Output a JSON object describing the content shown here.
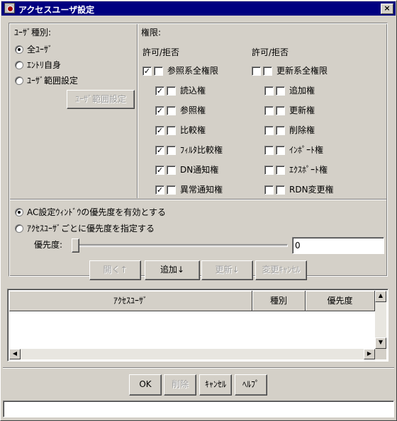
{
  "window": {
    "title": "アクセスユーザ設定",
    "close_glyph": "×"
  },
  "user_type": {
    "heading": "ﾕｰｻﾞ種別:",
    "options": [
      {
        "label": "全ﾕｰｻﾞ",
        "selected": true
      },
      {
        "label": "ｴﾝﾄﾘ自身",
        "selected": false
      },
      {
        "label": "ﾕｰｻﾞ範囲設定",
        "selected": false
      }
    ],
    "range_button": "ﾕｰｻﾞ範囲設定"
  },
  "permissions": {
    "heading": "権限:",
    "left_col_header": "許可/拒否",
    "right_col_header": "許可/拒否",
    "left": [
      {
        "label": "参照系全権限",
        "allow": true,
        "deny": false
      },
      {
        "label": "読込権",
        "allow": true,
        "deny": false
      },
      {
        "label": "参照権",
        "allow": true,
        "deny": false
      },
      {
        "label": "比較権",
        "allow": true,
        "deny": false
      },
      {
        "label": "ﾌｨﾙﾀ比較権",
        "allow": true,
        "deny": false
      },
      {
        "label": "DN通知権",
        "allow": true,
        "deny": false
      },
      {
        "label": "異常通知権",
        "allow": true,
        "deny": false
      }
    ],
    "right": [
      {
        "label": "更新系全権限",
        "allow": false,
        "deny": false
      },
      {
        "label": "追加権",
        "allow": false,
        "deny": false
      },
      {
        "label": "更新権",
        "allow": false,
        "deny": false
      },
      {
        "label": "削除権",
        "allow": false,
        "deny": false
      },
      {
        "label": "ｲﾝﾎﾟｰﾄ権",
        "allow": false,
        "deny": false
      },
      {
        "label": "ｴｸｽﾎﾟｰﾄ権",
        "allow": false,
        "deny": false
      },
      {
        "label": "RDN変更権",
        "allow": false,
        "deny": false
      }
    ]
  },
  "priority": {
    "opt_enable": "AC設定ｳｨﾝﾄﾞｳの優先度を有効とする",
    "opt_per_user": "ｱｸｾｽﾕｰｻﾞごとに優先度を指定する",
    "selected": "opt_enable",
    "label": "優先度:",
    "value": "0",
    "slider_level": 0
  },
  "actions": {
    "open": "開く↑",
    "add": "追加↓",
    "update": "更新↓",
    "cancel_change": "変更ｷｬﾝｾﾙ"
  },
  "table": {
    "headers": [
      "ｱｸｾｽﾕｰｻﾞ",
      "種別",
      "優先度"
    ],
    "rows": []
  },
  "footer": {
    "ok": "OK",
    "delete": "削除",
    "cancel": "ｷｬﾝｾﾙ",
    "help": "ﾍﾙﾌﾟ",
    "status": ""
  },
  "colors": {
    "titlebar": "#000080",
    "face": "#d4d0c8"
  }
}
